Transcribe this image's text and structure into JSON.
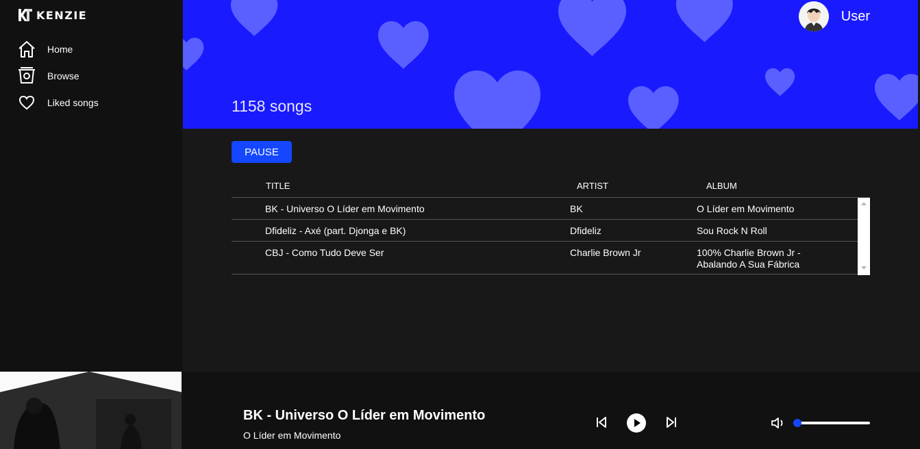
{
  "brand": {
    "name": "KENZIE"
  },
  "nav": [
    {
      "label": "Home",
      "icon": "home-icon"
    },
    {
      "label": "Browse",
      "icon": "browse-icon"
    },
    {
      "label": "Liked songs",
      "icon": "heart-icon"
    }
  ],
  "header": {
    "song_count": "1158 songs",
    "user_name": "User",
    "background_color": "#1a1aff"
  },
  "actions": {
    "pause_label": "PAUSE",
    "accent_color": "#1447ff"
  },
  "table": {
    "headers": {
      "title": "TITLE",
      "artist": "ARTIST",
      "album": "ALBUM"
    },
    "rows": [
      {
        "title": "BK - Universo O Líder em Movimento",
        "artist": "BK",
        "album": "O Líder em Movimento"
      },
      {
        "title": "Dfideliz - Axé (part. Djonga e BK)",
        "artist": "Dfideliz",
        "album": "Sou Rock N Roll"
      },
      {
        "title": "CBJ - Como Tudo Deve Ser",
        "artist": "Charlie Brown Jr",
        "album": "100% Charlie Brown Jr - Abalando A Sua Fábrica"
      }
    ]
  },
  "player": {
    "title": "BK - Universo O Líder em Movimento",
    "album": "O Líder em Movimento",
    "volume": 0.02
  }
}
